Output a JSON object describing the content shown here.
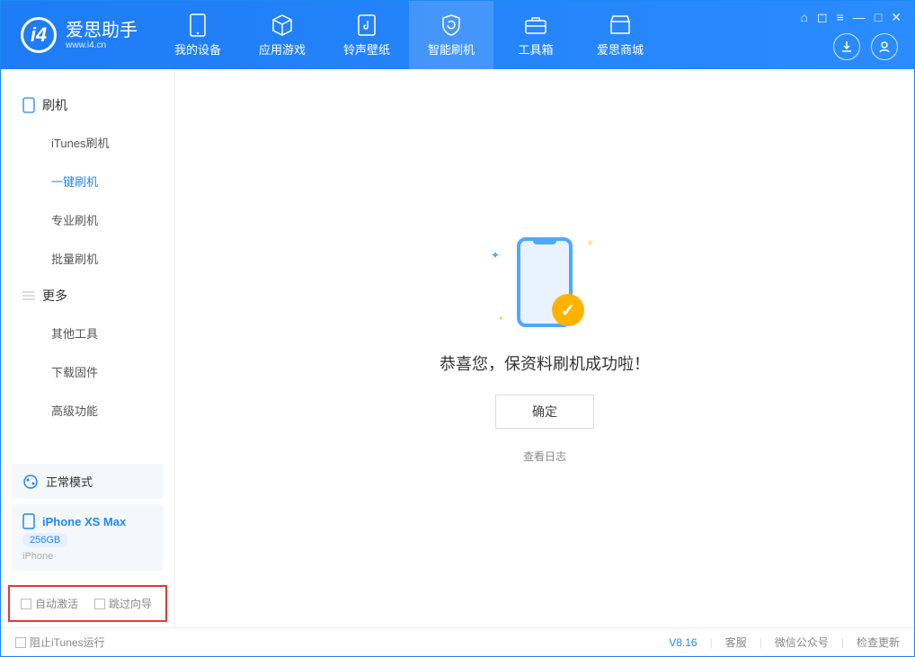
{
  "app": {
    "title": "爱思助手",
    "subtitle": "www.i4.cn"
  },
  "tabs": [
    "我的设备",
    "应用游戏",
    "铃声壁纸",
    "智能刷机",
    "工具箱",
    "爱思商城"
  ],
  "sidebar": {
    "group1": {
      "title": "刷机",
      "items": [
        "iTunes刷机",
        "一键刷机",
        "专业刷机",
        "批量刷机"
      ],
      "activeIndex": 1
    },
    "group2": {
      "title": "更多",
      "items": [
        "其他工具",
        "下载固件",
        "高级功能"
      ]
    }
  },
  "device": {
    "mode": "正常模式",
    "name": "iPhone XS Max",
    "capacity": "256GB",
    "sub": "iPhone"
  },
  "checkboxes": {
    "auto_activate": "自动激活",
    "skip_guide": "跳过向导"
  },
  "main": {
    "success_text": "恭喜您，保资料刷机成功啦！",
    "ok": "确定",
    "view_log": "查看日志"
  },
  "footer": {
    "block_itunes": "阻止iTunes运行",
    "version": "V8.16",
    "links": [
      "客服",
      "微信公众号",
      "检查更新"
    ]
  }
}
